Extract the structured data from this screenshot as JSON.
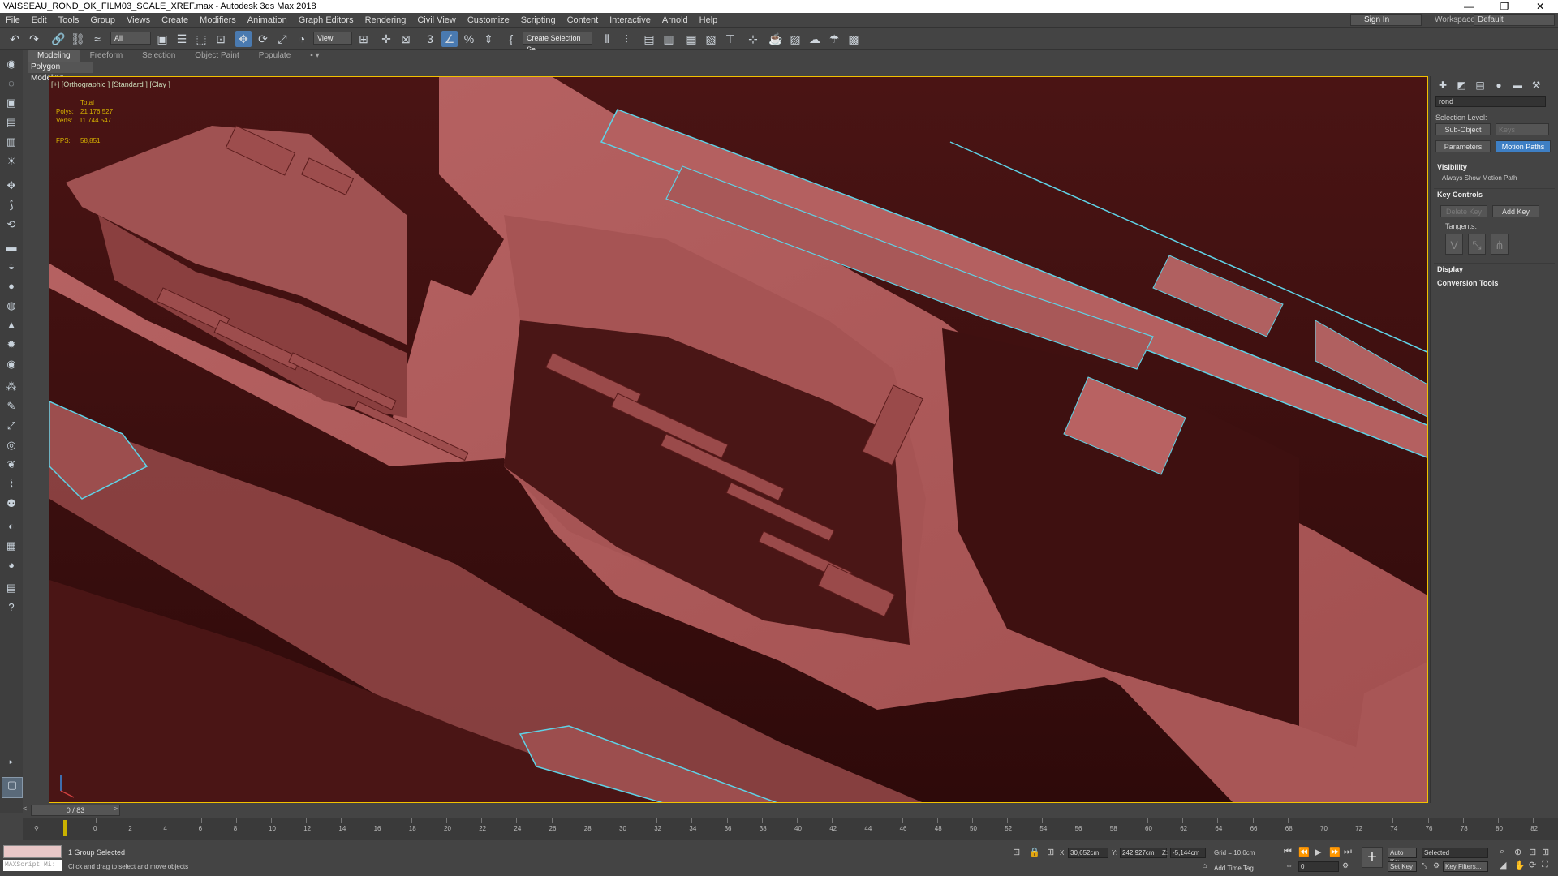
{
  "window": {
    "title": "VAISSEAU_ROND_OK_FILM03_SCALE_XREF.max - Autodesk 3ds Max 2018",
    "controls": [
      "—",
      "❐",
      "✕"
    ]
  },
  "menu": [
    "File",
    "Edit",
    "Tools",
    "Group",
    "Views",
    "Create",
    "Modifiers",
    "Animation",
    "Graph Editors",
    "Rendering",
    "Civil View",
    "Customize",
    "Scripting",
    "Content",
    "Interactive",
    "Arnold",
    "Help"
  ],
  "account": {
    "sign_in": "Sign In",
    "workspaces_label": "Workspaces:",
    "workspace_value": "Default"
  },
  "toolbar": {
    "filter_value": "All",
    "ref_coord_value": "View",
    "selection_set_placeholder": "Create Selection Se"
  },
  "ribbon": {
    "tabs": [
      "Modeling",
      "Freeform",
      "Selection",
      "Object Paint",
      "Populate"
    ],
    "active_tab": "Modeling",
    "sub_label": "Polygon Modeling"
  },
  "viewport": {
    "label": "[+] [Orthographic ] [Standard ] [Clay ]",
    "stats": {
      "total_label": "Total",
      "polys_label": "Polys:",
      "polys_value": "21 176 527",
      "verts_label": "Verts:",
      "verts_value": "11 744 547",
      "fps_label": "FPS:",
      "fps_value": "58,851"
    }
  },
  "command_panel": {
    "object_name": "rond",
    "selection_level_label": "Selection Level:",
    "sub_object_button": "Sub-Object",
    "keys_value": "Keys",
    "parameters_button": "Parameters",
    "motion_paths_button": "Motion Paths",
    "visibility_header": "Visibility",
    "always_show_label": "Always Show Motion Path",
    "key_controls_header": "Key Controls",
    "delete_key_button": "Delete Key",
    "add_key_button": "Add Key",
    "tangents_label": "Tangents:",
    "display_header": "Display",
    "conversion_tools_header": "Conversion Tools"
  },
  "timeline": {
    "slider_label": "0 / 83",
    "prev": "<",
    "next": ">",
    "ticks": [
      "0",
      "2",
      "4",
      "6",
      "8",
      "10",
      "12",
      "14",
      "16",
      "18",
      "20",
      "22",
      "24",
      "26",
      "28",
      "30",
      "32",
      "34",
      "36",
      "38",
      "40",
      "42",
      "44",
      "46",
      "48",
      "50",
      "52",
      "54",
      "56",
      "58",
      "60",
      "62",
      "64",
      "66",
      "68",
      "70",
      "72",
      "74",
      "76",
      "78",
      "80",
      "82"
    ]
  },
  "status": {
    "maxscript_label": "MAXScript Mi:",
    "selection_status": "1 Group Selected",
    "prompt": "Click and drag to select and move objects",
    "x_label": "X:",
    "x_value": "30,652cm",
    "y_label": "Y:",
    "y_value": "242,927cm",
    "z_label": "Z:",
    "z_value": "-5,144cm",
    "grid": "Grid = 10,0cm",
    "add_time_tag": "Add Time Tag",
    "auto_key": "Auto Key",
    "set_key": "Set Key",
    "selected_value": "Selected",
    "frame_value": "0",
    "key_filters": "Key Filters..."
  },
  "colors": {
    "surface": "#a85656",
    "shadow": "#3a0e0e",
    "edge_highlight": "#5fd2e6",
    "active_blue": "#3e7fc4"
  }
}
